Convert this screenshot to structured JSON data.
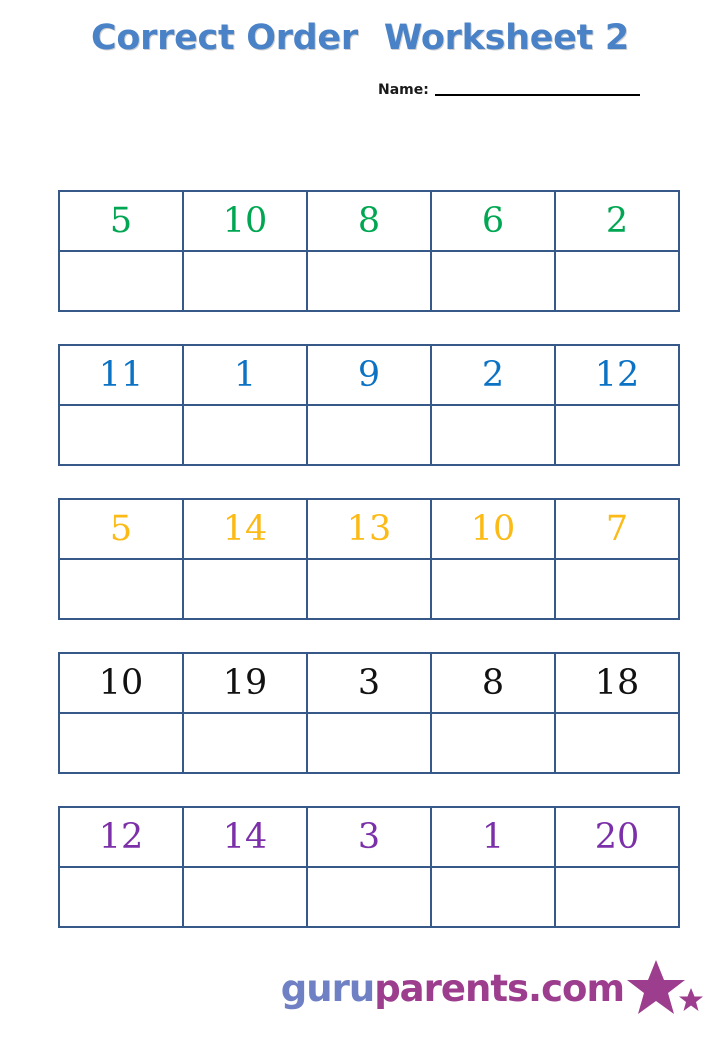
{
  "header": {
    "title_main": "Correct Order",
    "title_sub": "Worksheet 2",
    "name_label": "Name:",
    "name_value": ""
  },
  "colors": {
    "title_blue": "#4a82c8",
    "border_blue": "#36598a",
    "row_green": "#00a651",
    "row_blue": "#0b72c4",
    "row_amber": "#fbba16",
    "row_black": "#111111",
    "row_purple": "#7b2fa8",
    "logo_guru": "#6f81c4",
    "logo_parents": "#9c3d8e"
  },
  "worksheet": {
    "rows": [
      {
        "color": "#00a651",
        "numbers": [
          "5",
          "10",
          "8",
          "6",
          "2"
        ],
        "answers": [
          "",
          "",
          "",
          "",
          ""
        ]
      },
      {
        "color": "#0b72c4",
        "numbers": [
          "11",
          "1",
          "9",
          "2",
          "12"
        ],
        "answers": [
          "",
          "",
          "",
          "",
          ""
        ]
      },
      {
        "color": "#fbba16",
        "numbers": [
          "5",
          "14",
          "13",
          "10",
          "7"
        ],
        "answers": [
          "",
          "",
          "",
          "",
          ""
        ]
      },
      {
        "color": "#111111",
        "numbers": [
          "10",
          "19",
          "3",
          "8",
          "18"
        ],
        "answers": [
          "",
          "",
          "",
          "",
          ""
        ]
      },
      {
        "color": "#7b2fa8",
        "numbers": [
          "12",
          "14",
          "3",
          "1",
          "20"
        ],
        "answers": [
          "",
          "",
          "",
          "",
          ""
        ]
      }
    ]
  },
  "footer": {
    "logo_part1": "guru",
    "logo_part2": "parents.com",
    "star_icon": "star-icon"
  }
}
